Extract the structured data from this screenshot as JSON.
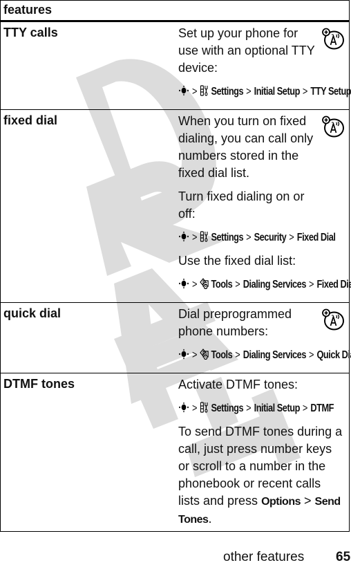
{
  "watermark": "DRAFT",
  "table": {
    "header": "features",
    "rows": [
      {
        "name": "TTY calls",
        "has_network_icon": true,
        "blocks": [
          {
            "type": "text",
            "text": "Set up your phone for use with an optional TTY device:"
          },
          {
            "type": "path",
            "icon": "settings-icon",
            "steps": [
              "Settings",
              "Initial Setup",
              "TTY Setup"
            ]
          }
        ]
      },
      {
        "name": "fixed dial",
        "has_network_icon": true,
        "blocks": [
          {
            "type": "text",
            "text": "When you turn on fixed dialing, you can call only numbers stored in the fixed dial list."
          },
          {
            "type": "text",
            "text": "Turn fixed dialing on or off:"
          },
          {
            "type": "path",
            "icon": "settings-icon",
            "steps": [
              "Settings",
              "Security",
              "Fixed Dial"
            ]
          },
          {
            "type": "text",
            "text": "Use the fixed dial list:"
          },
          {
            "type": "path",
            "icon": "tools-icon",
            "steps": [
              "Tools",
              "Dialing Services",
              "Fixed Dial"
            ]
          }
        ]
      },
      {
        "name": "quick dial",
        "has_network_icon": true,
        "blocks": [
          {
            "type": "text",
            "text": "Dial preprogrammed phone numbers:"
          },
          {
            "type": "path",
            "icon": "tools-icon",
            "steps": [
              "Tools",
              "Dialing Services",
              "Quick Dial"
            ]
          }
        ]
      },
      {
        "name": "DTMF tones",
        "has_network_icon": false,
        "blocks": [
          {
            "type": "text",
            "text": "Activate DTMF tones:"
          },
          {
            "type": "path",
            "icon": "settings-icon",
            "steps": [
              "Settings",
              "Initial Setup",
              "DTMF"
            ]
          },
          {
            "type": "rich",
            "prefix": "To send DTMF tones during a call, just press number keys or scroll to a number in the phonebook or recent calls lists and press ",
            "keywords": [
              "Options",
              "Send Tones"
            ],
            "suffix": "."
          }
        ]
      }
    ]
  },
  "footer": {
    "section": "other features",
    "page_number": "65"
  }
}
